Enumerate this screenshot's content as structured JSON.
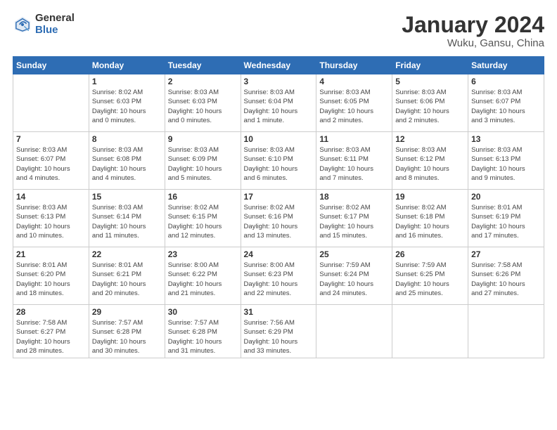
{
  "header": {
    "logo_general": "General",
    "logo_blue": "Blue",
    "month": "January 2024",
    "location": "Wuku, Gansu, China"
  },
  "weekdays": [
    "Sunday",
    "Monday",
    "Tuesday",
    "Wednesday",
    "Thursday",
    "Friday",
    "Saturday"
  ],
  "weeks": [
    [
      {
        "day": "",
        "info": ""
      },
      {
        "day": "1",
        "info": "Sunrise: 8:02 AM\nSunset: 6:03 PM\nDaylight: 10 hours\nand 0 minutes."
      },
      {
        "day": "2",
        "info": "Sunrise: 8:03 AM\nSunset: 6:03 PM\nDaylight: 10 hours\nand 0 minutes."
      },
      {
        "day": "3",
        "info": "Sunrise: 8:03 AM\nSunset: 6:04 PM\nDaylight: 10 hours\nand 1 minute."
      },
      {
        "day": "4",
        "info": "Sunrise: 8:03 AM\nSunset: 6:05 PM\nDaylight: 10 hours\nand 2 minutes."
      },
      {
        "day": "5",
        "info": "Sunrise: 8:03 AM\nSunset: 6:06 PM\nDaylight: 10 hours\nand 2 minutes."
      },
      {
        "day": "6",
        "info": "Sunrise: 8:03 AM\nSunset: 6:07 PM\nDaylight: 10 hours\nand 3 minutes."
      }
    ],
    [
      {
        "day": "7",
        "info": "Sunrise: 8:03 AM\nSunset: 6:07 PM\nDaylight: 10 hours\nand 4 minutes."
      },
      {
        "day": "8",
        "info": "Sunrise: 8:03 AM\nSunset: 6:08 PM\nDaylight: 10 hours\nand 4 minutes."
      },
      {
        "day": "9",
        "info": "Sunrise: 8:03 AM\nSunset: 6:09 PM\nDaylight: 10 hours\nand 5 minutes."
      },
      {
        "day": "10",
        "info": "Sunrise: 8:03 AM\nSunset: 6:10 PM\nDaylight: 10 hours\nand 6 minutes."
      },
      {
        "day": "11",
        "info": "Sunrise: 8:03 AM\nSunset: 6:11 PM\nDaylight: 10 hours\nand 7 minutes."
      },
      {
        "day": "12",
        "info": "Sunrise: 8:03 AM\nSunset: 6:12 PM\nDaylight: 10 hours\nand 8 minutes."
      },
      {
        "day": "13",
        "info": "Sunrise: 8:03 AM\nSunset: 6:13 PM\nDaylight: 10 hours\nand 9 minutes."
      }
    ],
    [
      {
        "day": "14",
        "info": "Sunrise: 8:03 AM\nSunset: 6:13 PM\nDaylight: 10 hours\nand 10 minutes."
      },
      {
        "day": "15",
        "info": "Sunrise: 8:03 AM\nSunset: 6:14 PM\nDaylight: 10 hours\nand 11 minutes."
      },
      {
        "day": "16",
        "info": "Sunrise: 8:02 AM\nSunset: 6:15 PM\nDaylight: 10 hours\nand 12 minutes."
      },
      {
        "day": "17",
        "info": "Sunrise: 8:02 AM\nSunset: 6:16 PM\nDaylight: 10 hours\nand 13 minutes."
      },
      {
        "day": "18",
        "info": "Sunrise: 8:02 AM\nSunset: 6:17 PM\nDaylight: 10 hours\nand 15 minutes."
      },
      {
        "day": "19",
        "info": "Sunrise: 8:02 AM\nSunset: 6:18 PM\nDaylight: 10 hours\nand 16 minutes."
      },
      {
        "day": "20",
        "info": "Sunrise: 8:01 AM\nSunset: 6:19 PM\nDaylight: 10 hours\nand 17 minutes."
      }
    ],
    [
      {
        "day": "21",
        "info": "Sunrise: 8:01 AM\nSunset: 6:20 PM\nDaylight: 10 hours\nand 18 minutes."
      },
      {
        "day": "22",
        "info": "Sunrise: 8:01 AM\nSunset: 6:21 PM\nDaylight: 10 hours\nand 20 minutes."
      },
      {
        "day": "23",
        "info": "Sunrise: 8:00 AM\nSunset: 6:22 PM\nDaylight: 10 hours\nand 21 minutes."
      },
      {
        "day": "24",
        "info": "Sunrise: 8:00 AM\nSunset: 6:23 PM\nDaylight: 10 hours\nand 22 minutes."
      },
      {
        "day": "25",
        "info": "Sunrise: 7:59 AM\nSunset: 6:24 PM\nDaylight: 10 hours\nand 24 minutes."
      },
      {
        "day": "26",
        "info": "Sunrise: 7:59 AM\nSunset: 6:25 PM\nDaylight: 10 hours\nand 25 minutes."
      },
      {
        "day": "27",
        "info": "Sunrise: 7:58 AM\nSunset: 6:26 PM\nDaylight: 10 hours\nand 27 minutes."
      }
    ],
    [
      {
        "day": "28",
        "info": "Sunrise: 7:58 AM\nSunset: 6:27 PM\nDaylight: 10 hours\nand 28 minutes."
      },
      {
        "day": "29",
        "info": "Sunrise: 7:57 AM\nSunset: 6:28 PM\nDaylight: 10 hours\nand 30 minutes."
      },
      {
        "day": "30",
        "info": "Sunrise: 7:57 AM\nSunset: 6:28 PM\nDaylight: 10 hours\nand 31 minutes."
      },
      {
        "day": "31",
        "info": "Sunrise: 7:56 AM\nSunset: 6:29 PM\nDaylight: 10 hours\nand 33 minutes."
      },
      {
        "day": "",
        "info": ""
      },
      {
        "day": "",
        "info": ""
      },
      {
        "day": "",
        "info": ""
      }
    ]
  ]
}
